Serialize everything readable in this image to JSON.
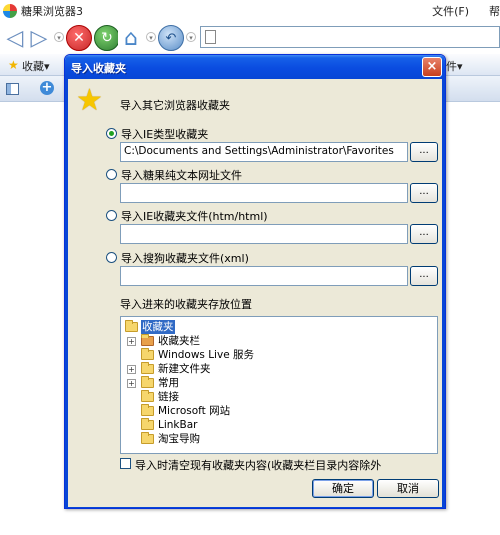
{
  "app": {
    "title": "糖果浏览器3"
  },
  "menu": {
    "file": "文件(F)",
    "help": "帮"
  },
  "navbar": {
    "back_icon": "back-arrow-icon",
    "forward_icon": "forward-arrow-icon",
    "stop_icon": "stop-icon",
    "refresh_icon": "refresh-icon",
    "home_icon": "home-icon",
    "undo_icon": "undo-icon",
    "address": ""
  },
  "favbar": {
    "favorites_label": "收藏▾",
    "right_label": "件▾"
  },
  "dialog": {
    "title": "导入收藏夹",
    "close": "×",
    "intro": "导入其它浏览器收藏夹",
    "options": [
      {
        "label": "导入IE类型收藏夹",
        "checked": true,
        "path": "C:\\Documents and Settings\\Administrator\\Favorites"
      },
      {
        "label": "导入糖果纯文本网址文件",
        "checked": false,
        "path": ""
      },
      {
        "label": "导入IE收藏夹文件(htm/html)",
        "checked": false,
        "path": ""
      },
      {
        "label": "导入搜狗收藏夹文件(xml)",
        "checked": false,
        "path": ""
      }
    ],
    "browse_label": "...",
    "location_label": "导入进来的收藏夹存放位置",
    "tree": [
      {
        "label": "收藏夹",
        "level": 0,
        "expander": "",
        "selected": true,
        "special": false
      },
      {
        "label": "收藏夹栏",
        "level": 1,
        "expander": "+",
        "selected": false,
        "special": true
      },
      {
        "label": "Windows Live 服务",
        "level": 1,
        "expander": "",
        "selected": false,
        "special": false
      },
      {
        "label": "新建文件夹",
        "level": 1,
        "expander": "+",
        "selected": false,
        "special": false
      },
      {
        "label": "常用",
        "level": 1,
        "expander": "+",
        "selected": false,
        "special": false
      },
      {
        "label": "链接",
        "level": 1,
        "expander": "",
        "selected": false,
        "special": false
      },
      {
        "label": "Microsoft 网站",
        "level": 1,
        "expander": "",
        "selected": false,
        "special": false
      },
      {
        "label": "LinkBar",
        "level": 1,
        "expander": "",
        "selected": false,
        "special": false
      },
      {
        "label": "淘宝导购",
        "level": 1,
        "expander": "",
        "selected": false,
        "special": false
      }
    ],
    "clear_checkbox_label": "导入时清空现有收藏夹内容(收藏夹栏目录内容除外",
    "clear_checked": false,
    "ok_label": "确定",
    "cancel_label": "取消"
  }
}
